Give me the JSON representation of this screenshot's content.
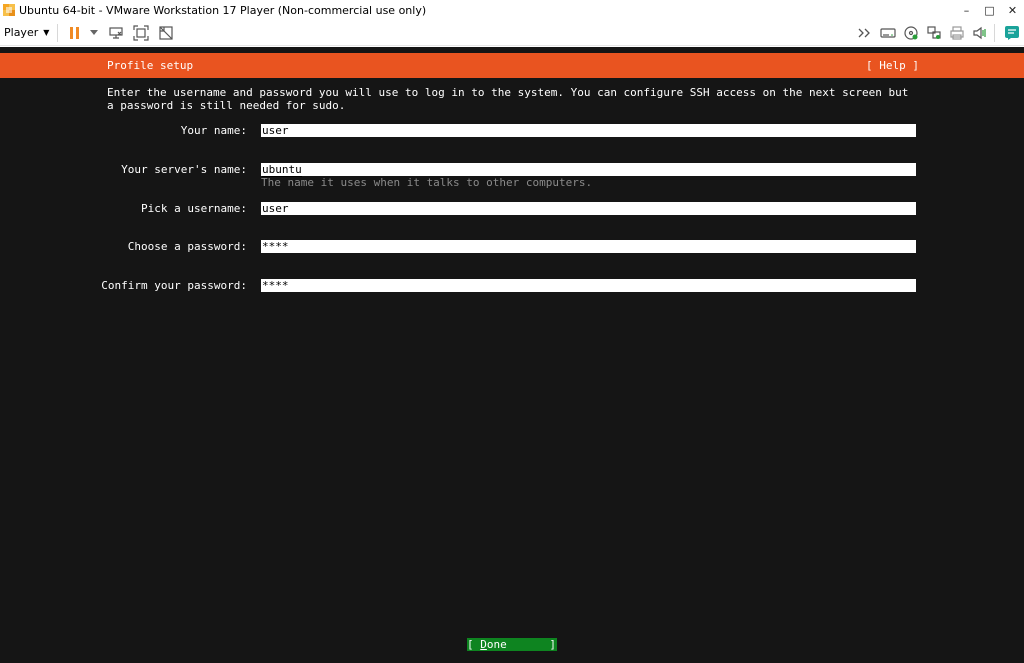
{
  "window": {
    "title": "Ubuntu 64-bit - VMware Workstation 17 Player (Non-commercial use only)",
    "controls": {
      "minimize": "–",
      "maximize": "□",
      "close": "✕"
    }
  },
  "toolbar": {
    "player_menu": "Player",
    "left_icons": [
      "pause-icon",
      "dropdown-arrow-icon",
      "send-ctrl-alt-del-icon",
      "fullscreen-icon",
      "unity-icon"
    ],
    "right_icons": [
      "more-icon",
      "hard-disk-icon",
      "cd-dvd-icon",
      "network-icon",
      "printer-icon",
      "sound-icon",
      "message-log-icon"
    ]
  },
  "installer": {
    "header_title": "Profile setup",
    "help_label": "[ Help ]",
    "intro": "Enter the username and password you will use to log in to the system. You can configure SSH access on the next screen but a password is still needed for sudo.",
    "fields": [
      {
        "label": "Your name:",
        "value": "user"
      },
      {
        "label": "Your server's name:",
        "value": "ubuntu",
        "hint": "The name it uses when it talks to other computers."
      },
      {
        "label": "Pick a username:",
        "value": "user"
      },
      {
        "label": "Choose a password:",
        "value": "****"
      },
      {
        "label": "Confirm your password:",
        "value": "****"
      }
    ],
    "done_button": {
      "open": "[ ",
      "key": "D",
      "rest": "one",
      "close": "]"
    }
  },
  "colors": {
    "header_orange": "#e95420",
    "screen_bg": "#151515",
    "done_green": "#0e8420",
    "hint_gray": "#8a8a8a"
  }
}
